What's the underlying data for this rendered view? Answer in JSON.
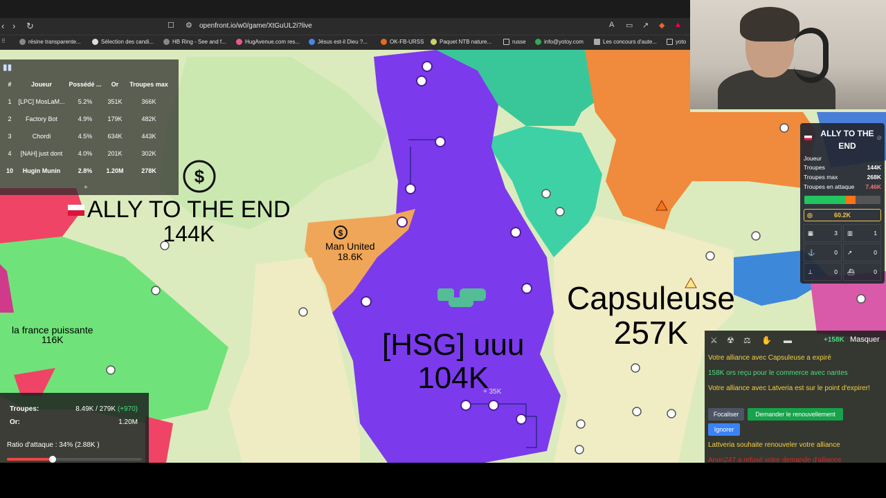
{
  "browser": {
    "url": "openfront.io/w0/game/XtGuUL2i?live",
    "bookmarks": [
      "résine transparente...",
      "Sélection des candi...",
      "HB Ring - See and f...",
      "HugAvenue.com res...",
      "Jésus est-il Dieu ?...",
      "OK-FB-URSS",
      "Paquet NTB nature...",
      "russe",
      "info@yotoy.com",
      "Les concours d'aute...",
      "yoto"
    ]
  },
  "leaderboard": {
    "headers": [
      "#",
      "Joueur",
      "Possédé ...",
      "Or",
      "Troupes max"
    ],
    "rows": [
      {
        "rank": "1",
        "player": "[LPC] MosLaM...",
        "owned": "5.2%",
        "gold": "351K",
        "max": "366K"
      },
      {
        "rank": "2",
        "player": "Factory Bot",
        "owned": "4.9%",
        "gold": "179K",
        "max": "482K"
      },
      {
        "rank": "3",
        "player": "Chordi",
        "owned": "4.5%",
        "gold": "634K",
        "max": "443K"
      },
      {
        "rank": "4",
        "player": "[NAH] just dont",
        "owned": "4.0%",
        "gold": "201K",
        "max": "302K"
      },
      {
        "rank": "10",
        "player": "Hugin Munin",
        "owned": "2.8%",
        "gold": "1.20M",
        "max": "278K"
      }
    ],
    "expand": "+"
  },
  "map_labels": {
    "ally": {
      "name": "ALLY TO THE END",
      "troops": "144K"
    },
    "man_united": {
      "name": "Man United",
      "troops": "18.6K"
    },
    "hsg": {
      "name": "[HSG] uuu",
      "troops": "104K"
    },
    "capsuleuse": {
      "name": "Capsuleuse",
      "troops": "257K"
    },
    "france": {
      "name": "la france puissante",
      "troops": "116K"
    },
    "floating": "+ 35K"
  },
  "player_info": {
    "name": "ALLY TO THE END",
    "type": "Joueur",
    "troops_label": "Troupes",
    "troops": "144K",
    "max_label": "Troupes max",
    "max": "268K",
    "attack_label": "Troupes en attaque",
    "attack": "7.46K",
    "troop_fraction": 0.54,
    "attack_fraction": 0.13,
    "gold": "60.2K",
    "buildings": [
      {
        "icon": "city-icon",
        "count": "3"
      },
      {
        "icon": "factory-icon",
        "count": "1"
      },
      {
        "icon": "port-icon",
        "count": "0"
      },
      {
        "icon": "missile-silo-icon",
        "count": "0"
      },
      {
        "icon": "sam-launcher-icon",
        "count": "0"
      },
      {
        "icon": "warship-icon",
        "count": "0"
      }
    ],
    "colors": {
      "green": "#22c55e",
      "orange": "#f97316",
      "attack": "#f87171"
    }
  },
  "events": {
    "gain": "+158K",
    "hide": "Masquer",
    "items": [
      "Votre alliance avec Capsuleuse a expiré",
      "158K ors reçu pour le commerce avec nantes",
      "Votre alliance avec Latveria est sur le point d'expirer!",
      "Lattveria souhaite renouveler votre alliance",
      "Anon247 a refusé votre demande d'alliance"
    ],
    "focus_btn": "Focaliser",
    "renew_btn": "Demander le renouvellement",
    "ignore_btn": "Ignorer"
  },
  "troops_panel": {
    "troops_label": "Troupes:",
    "troops_value": "8.49K / 279K",
    "troops_gain": "(+970)",
    "gold_label": "Or:",
    "gold_value": "1.20M",
    "ratio": "Ratio d'attaque : 34% (2.88K )",
    "ratio_fraction": 0.34
  }
}
